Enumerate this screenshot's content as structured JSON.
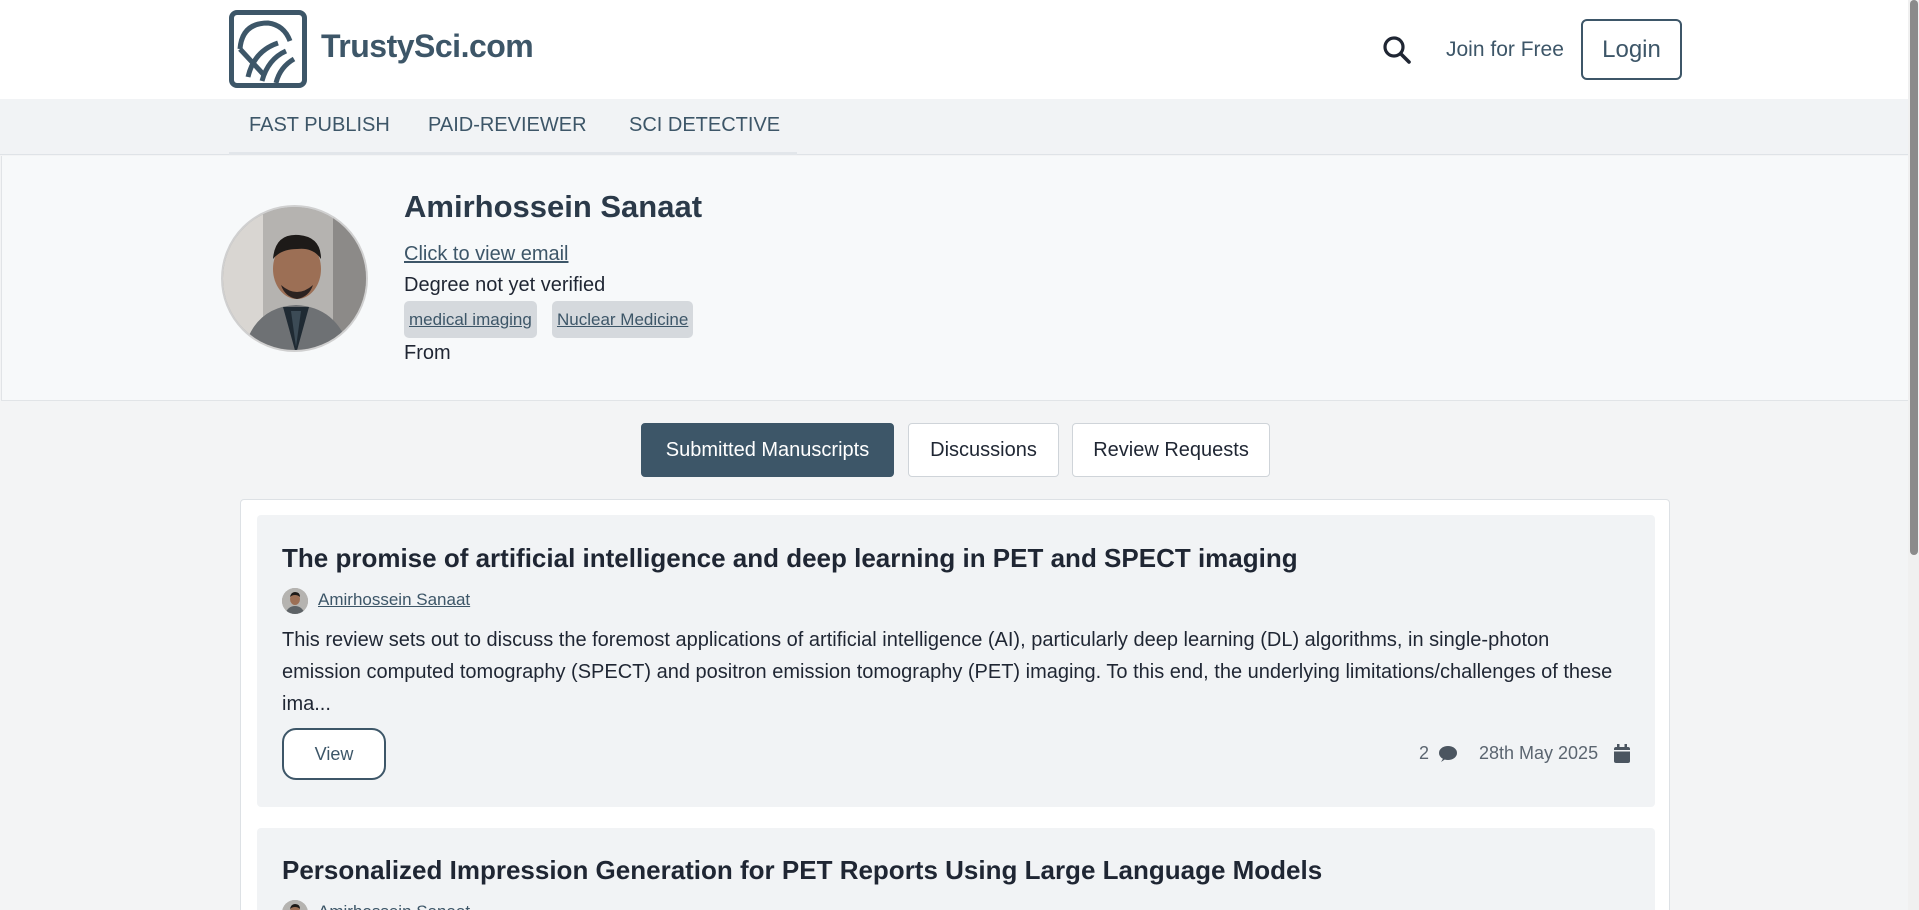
{
  "header": {
    "brand": "TrustySci.com",
    "join_label": "Join for Free",
    "login_label": "Login"
  },
  "nav": {
    "items": [
      "FAST PUBLISH",
      "PAID-REVIEWER",
      "SCI DETECTIVE"
    ]
  },
  "profile": {
    "name": "Amirhossein Sanaat",
    "email_link": "Click to view email",
    "degree_status": "Degree not yet verified",
    "tags": [
      "medical imaging",
      "Nuclear Medicine"
    ],
    "from_label": "From"
  },
  "tabs": {
    "items": [
      "Submitted Manuscripts",
      "Discussions",
      "Review Requests"
    ],
    "active": "Submitted Manuscripts"
  },
  "manuscripts": [
    {
      "title": "The promise of artificial intelligence and deep learning in PET and SPECT imaging",
      "author": "Amirhossein Sanaat",
      "abstract_lines": [
        "This review sets out to discuss the foremost applications of artificial intelligence (AI), particularly deep learning (DL) algorithms, in single-photon",
        "emission computed tomography (SPECT) and positron emission tomography (PET) imaging. To this end, the underlying limitations/challenges of these",
        "ima..."
      ],
      "view_label": "View",
      "comment_count": "2",
      "date": "28th May 2025"
    },
    {
      "title": "Personalized Impression Generation for PET Reports Using Large Language Models",
      "author": "Amirhossein Sanaat"
    }
  ],
  "icons": {
    "search": "search-icon",
    "comment": "comment-icon",
    "calendar": "calendar-icon"
  },
  "colors": {
    "brand": "#3d5668",
    "page_bg": "#f3f4f5",
    "card_bg": "#f1f3f5",
    "tag_bg": "#d5d9dd"
  }
}
